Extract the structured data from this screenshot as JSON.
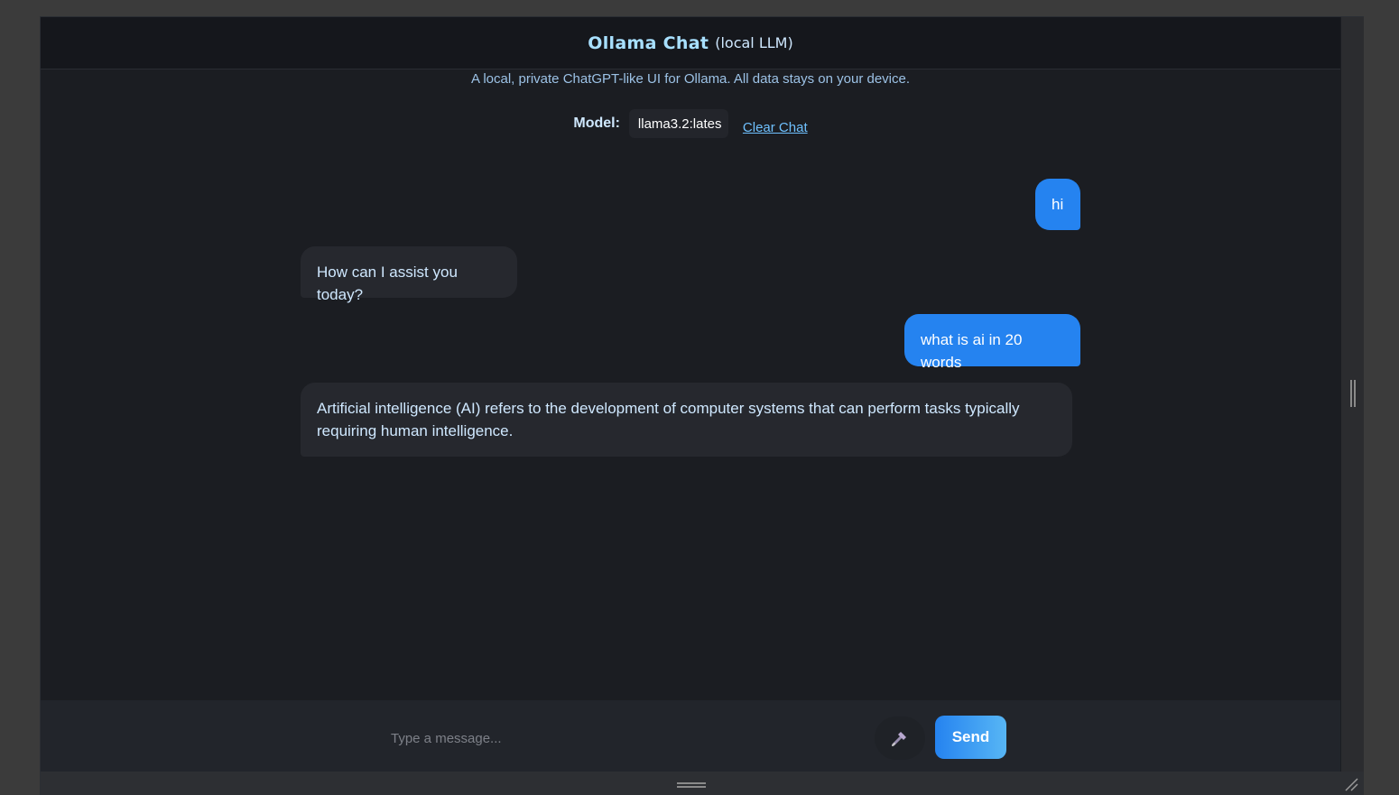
{
  "header": {
    "title": "Ollama Chat",
    "title_suffix": "(local LLM)"
  },
  "subtitle": "A local, private ChatGPT-like UI for Ollama. All data stays on your device.",
  "model": {
    "label": "Model:",
    "selected": "llama3.2:lates",
    "clear_label": "Clear Chat"
  },
  "messages": [
    {
      "role": "user",
      "text": "hi"
    },
    {
      "role": "assistant",
      "text": "How can I assist you today?"
    },
    {
      "role": "user",
      "text": "what is ai in 20 words"
    },
    {
      "role": "assistant",
      "text": "Artificial intelligence (AI) refers to the development of computer systems that can perform tasks typically requiring human intelligence."
    }
  ],
  "composer": {
    "placeholder": "Type a message...",
    "mic_icon": "microphone-icon",
    "send_label": "Send"
  },
  "colors": {
    "accent": "#2583f0",
    "title": "#a8e0ff",
    "background": "#1b1d22"
  }
}
